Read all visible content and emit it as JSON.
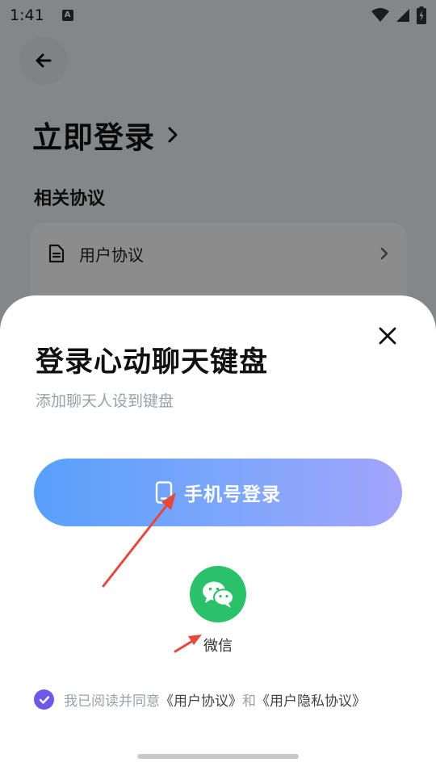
{
  "status_bar": {
    "time": "1:41",
    "notification_icon": "a-letter-icon",
    "icons": [
      "wifi-icon",
      "signal-icon",
      "battery-icon"
    ]
  },
  "background_page": {
    "title": "立即登录",
    "section_title": "相关协议",
    "items": [
      {
        "label": "用户协议",
        "icon": "document-icon"
      }
    ]
  },
  "sheet": {
    "title": "登录心动聊天键盘",
    "subtitle": "添加聊天人设到键盘",
    "phone_login_label": "手机号登录",
    "wechat_label": "微信",
    "consent": {
      "prefix": "我已阅读并同意",
      "link1": "《用户协议》",
      "middle": "和",
      "link2": "《用户隐私协议》"
    }
  },
  "colors": {
    "accent_gradient_start": "#58a0fb",
    "accent_gradient_end": "#a3a4fb",
    "wechat_green": "#2bc16a",
    "checkbox_purple": "#6f57e8",
    "annotation_red": "#e5483d"
  }
}
